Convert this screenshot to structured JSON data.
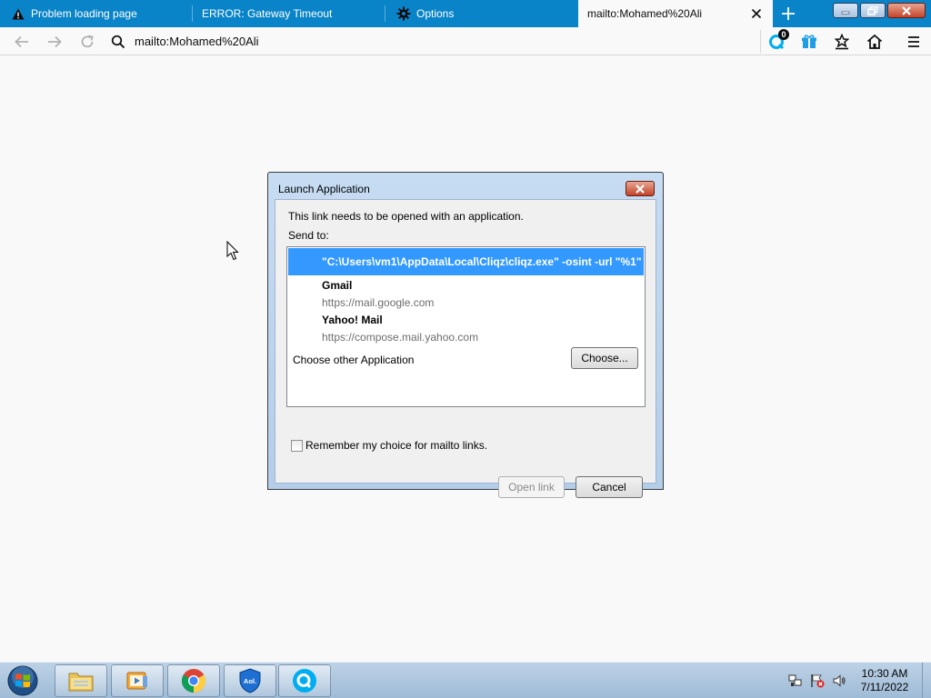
{
  "tabs": [
    {
      "label": "Problem loading page",
      "icon": "warning-icon"
    },
    {
      "label": "ERROR: Gateway Timeout",
      "icon": ""
    },
    {
      "label": "Options",
      "icon": "gear-icon"
    },
    {
      "label": "mailto:Mohamed%20Ali",
      "icon": "",
      "active": true
    }
  ],
  "urlbar": {
    "value": "mailto:Mohamed%20Ali"
  },
  "toolbar": {
    "cliqz_badge": "0"
  },
  "dialog": {
    "title": "Launch Application",
    "message": "This link needs to be opened with an application.",
    "send_to_label": "Send to:",
    "selected_app": "\"C:\\Users\\vm1\\AppData\\Local\\Cliqz\\cliqz.exe\" -osint -url \"%1\"",
    "apps": [
      {
        "name": "Gmail",
        "url": "https://mail.google.com"
      },
      {
        "name": "Yahoo! Mail",
        "url": "https://compose.mail.yahoo.com"
      }
    ],
    "choose_other_label": "Choose other Application",
    "choose_button": "Choose...",
    "remember_label": "Remember my choice for mailto links.",
    "remember_checked": false,
    "open_link_button": "Open link",
    "cancel_button": "Cancel"
  },
  "taskbar": {
    "items": [
      "file-explorer-icon",
      "media-player-icon",
      "chrome-icon",
      "aol-shield-icon",
      "cliqz-icon"
    ],
    "aol_label": "Aol.",
    "clock_time": "10:30 AM",
    "clock_date": "7/11/2022"
  },
  "colors": {
    "tabstrip": "#0a84c8",
    "selection": "#3399ff",
    "page_bg": "#f9f9fa"
  }
}
